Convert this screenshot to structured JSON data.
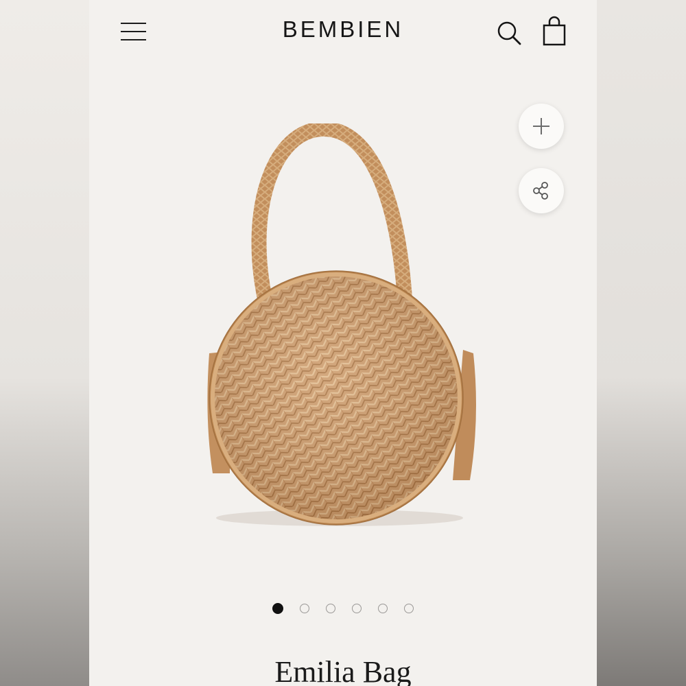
{
  "header": {
    "brand": "BEMBIEN",
    "menu_icon": "hamburger-menu-icon",
    "search_icon": "search-icon",
    "cart_icon": "shopping-bag-icon"
  },
  "gallery": {
    "zoom_icon": "plus-icon",
    "share_icon": "share-icon",
    "slide_count": 6,
    "active_slide": 1
  },
  "product": {
    "name": "Emilia Bag"
  },
  "colors": {
    "background": "#f3f1ee",
    "text": "#151515",
    "woven": "#cc9a6a"
  }
}
